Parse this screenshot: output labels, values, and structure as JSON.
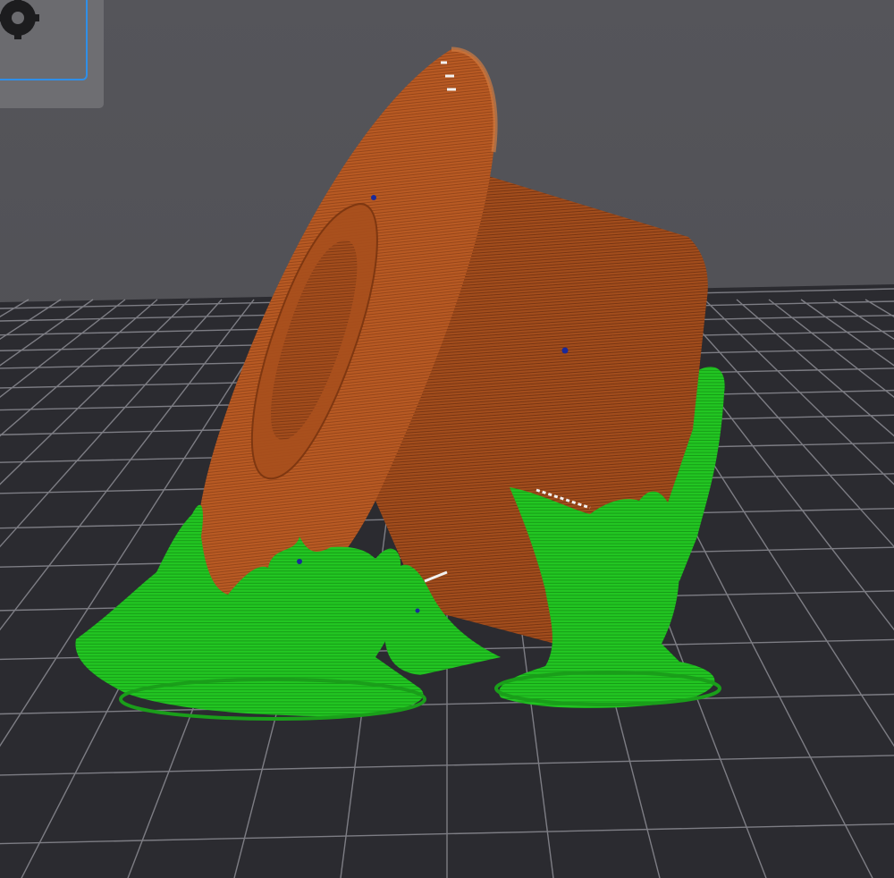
{
  "viewport": {
    "background_color": "#505055",
    "bed_color": "#2b2b30",
    "grid_color": "#8c8c93"
  },
  "object": {
    "color": "#b85a23",
    "layer_color": "#8a3f16"
  },
  "supports": {
    "color": "#1fc41f",
    "shade_color": "#128a12"
  },
  "toolbar": {
    "view_button_icon": "gear-icon",
    "active_color": "#2f8fe8"
  }
}
